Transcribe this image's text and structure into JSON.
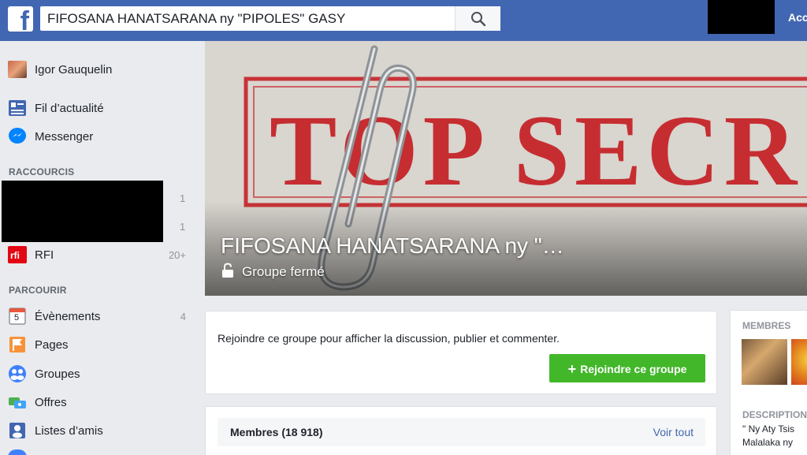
{
  "topbar": {
    "search_value": "FIFOSANA HANATSARANA ny \"PIPOLES\" GASY",
    "account_label": "Acc"
  },
  "sidebar": {
    "user_name": "Igor Gauquelin",
    "items_main": [
      {
        "label": "Fil d’actualité"
      },
      {
        "label": "Messenger"
      }
    ],
    "shortcuts_heading": "RACCOURCIS",
    "shortcut_counts": [
      "1",
      "1"
    ],
    "rfi_label": "RFI",
    "rfi_count": "20+",
    "browse_heading": "PARCOURIR",
    "browse_items": [
      {
        "label": "Évènements",
        "count": "4"
      },
      {
        "label": "Pages",
        "count": ""
      },
      {
        "label": "Groupes",
        "count": ""
      },
      {
        "label": "Offres",
        "count": ""
      },
      {
        "label": "Listes d’amis",
        "count": ""
      }
    ],
    "calendar_day": "5"
  },
  "cover": {
    "title": "FIFOSANA HANATSARANA ny \"…",
    "subtitle": "Groupe fermé",
    "stamp_text": "TOP SECR"
  },
  "join": {
    "text": "Rejoindre ce groupe pour afficher la discussion, publier et commenter.",
    "button": "Rejoindre ce groupe"
  },
  "members": {
    "title": "Membres (18 918)",
    "see_all": "Voir tout"
  },
  "right": {
    "members_heading": "MEMBRES",
    "description_heading": "DESCRIPTION",
    "description_lines": [
      "\" Ny Aty Tsis",
      "Malalaka ny"
    ]
  },
  "colors": {
    "brand": "#4267b2",
    "join_green": "#42b72a",
    "stamp_red": "#c4161c"
  }
}
